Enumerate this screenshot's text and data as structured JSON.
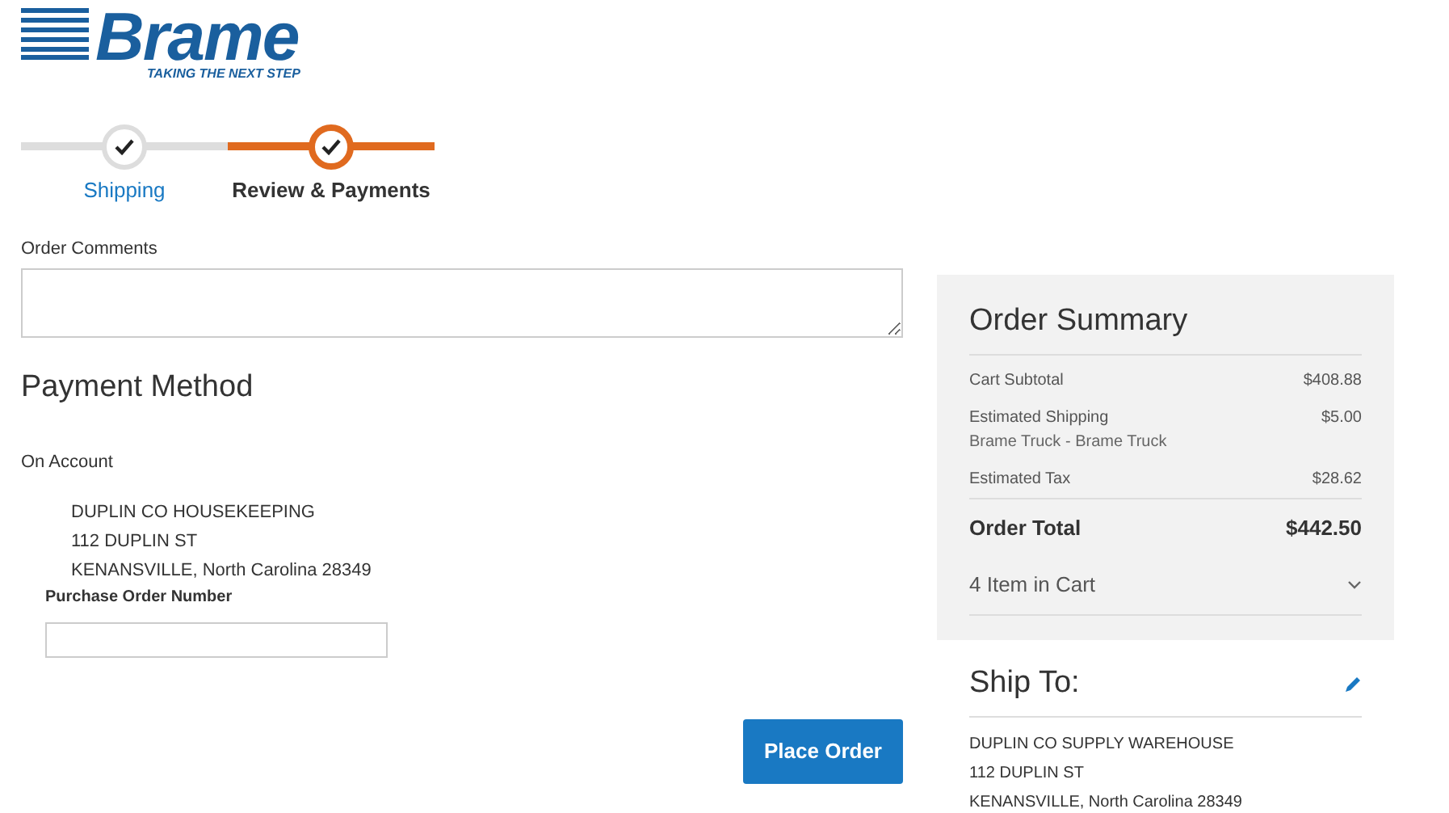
{
  "logo": {
    "name": "Brame",
    "tagline": "TAKING THE NEXT STEP"
  },
  "steps": [
    {
      "label": "Shipping",
      "selected": false
    },
    {
      "label": "Review & Payments",
      "selected": true
    }
  ],
  "order_comments": {
    "label": "Order Comments"
  },
  "payment": {
    "heading": "Payment Method",
    "method": "On Account",
    "address": [
      "DUPLIN CO HOUSEKEEPING",
      "112 DUPLIN ST",
      "KENANSVILLE, North Carolina 28349"
    ],
    "po_label": "Purchase Order Number"
  },
  "place_order": "Place Order",
  "summary": {
    "title": "Order Summary",
    "rows": [
      {
        "label": "Cart Subtotal",
        "value": "$408.88"
      },
      {
        "label": "Estimated Shipping",
        "sub": "Brame Truck - Brame Truck",
        "value": "$5.00"
      },
      {
        "label": "Estimated Tax",
        "value": "$28.62"
      }
    ],
    "total": {
      "label": "Order Total",
      "value": "$442.50"
    },
    "cart": {
      "label": "4 Item in Cart",
      "expanded": false
    }
  },
  "ship_to": {
    "title": "Ship To:",
    "address": [
      "DUPLIN CO SUPPLY WAREHOUSE",
      "112 DUPLIN ST",
      "KENANSVILLE, North Carolina 28349"
    ]
  }
}
